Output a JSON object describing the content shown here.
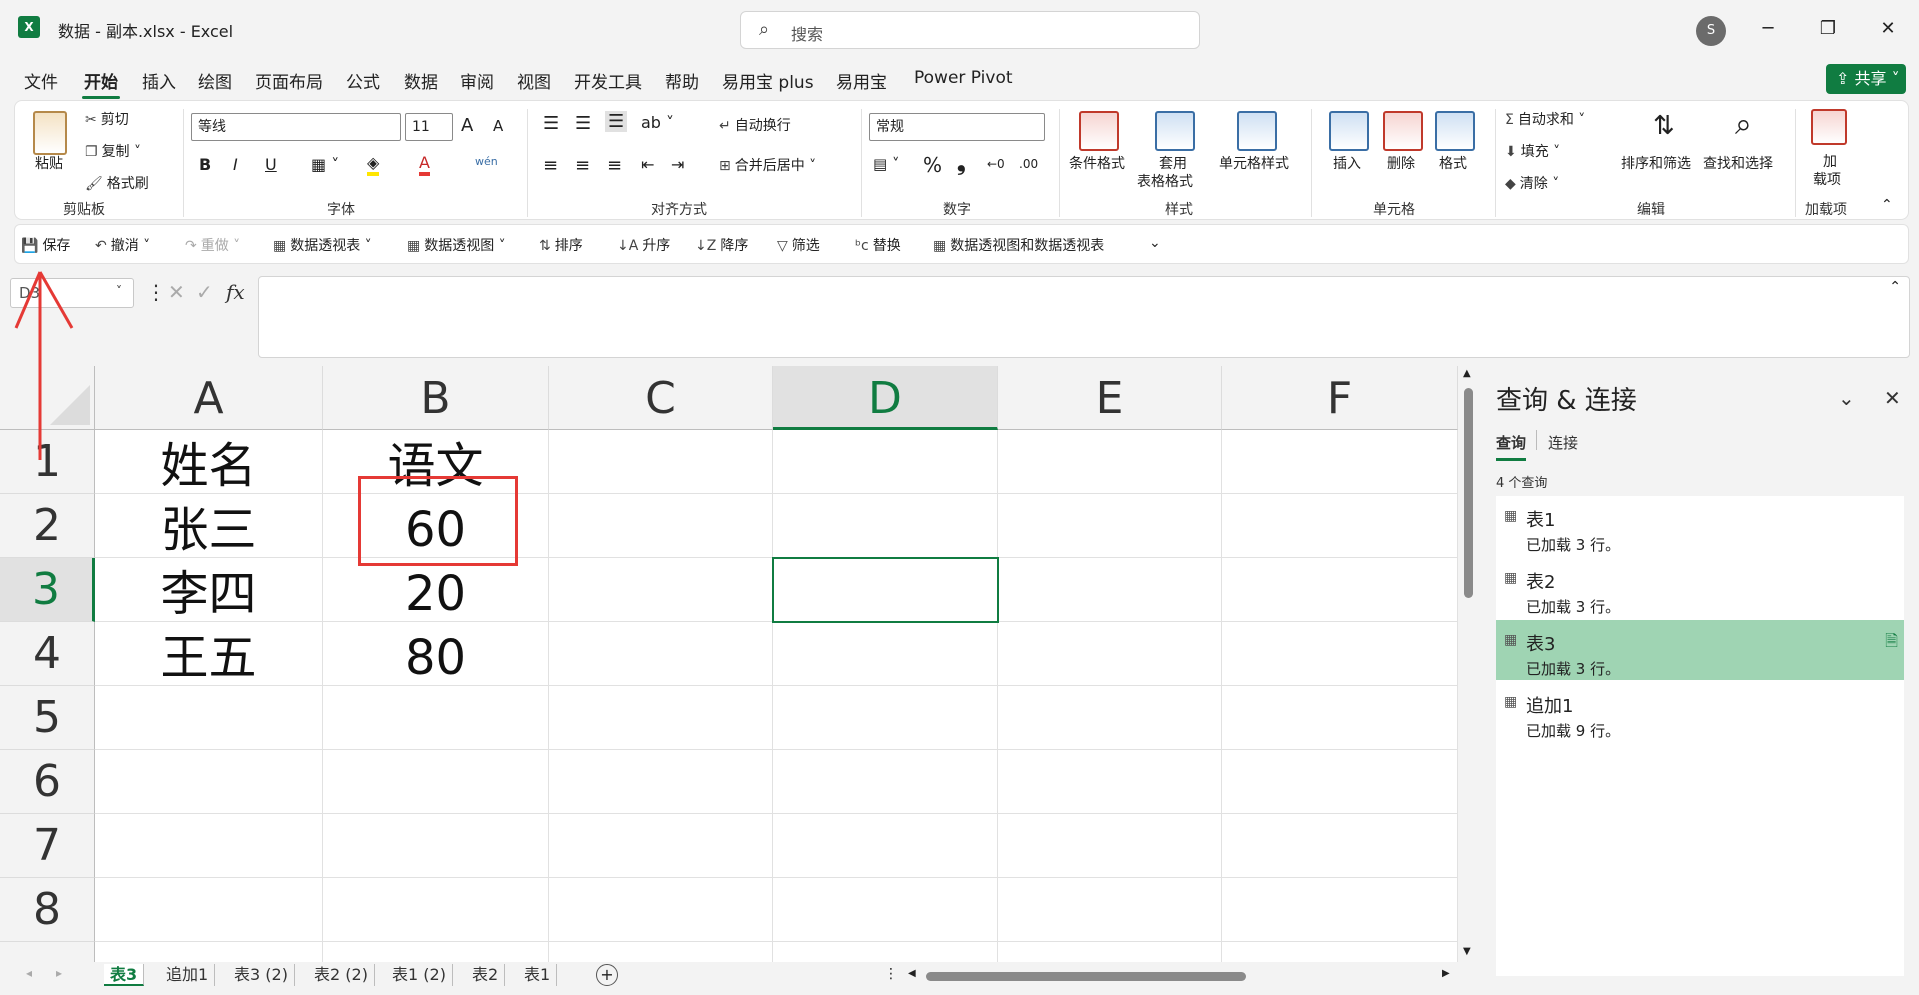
{
  "window": {
    "title": "数据 - 副本.xlsx  -  Excel",
    "app_letter": "X",
    "search_placeholder": "搜索",
    "user_initial": "S",
    "minimize": "─",
    "restore": "❐",
    "close": "✕"
  },
  "menu": {
    "items": [
      "文件",
      "开始",
      "插入",
      "绘图",
      "页面布局",
      "公式",
      "数据",
      "审阅",
      "视图",
      "开发工具",
      "帮助",
      "易用宝 plus",
      "易用宝",
      "Power Pivot"
    ],
    "active": "开始",
    "share": "共享"
  },
  "ribbon": {
    "clipboard": {
      "label": "剪贴板",
      "paste": "粘贴",
      "cut": "剪切",
      "copy": "复制",
      "format_painter": "格式刷"
    },
    "font": {
      "label": "字体",
      "name": "等线",
      "size": "11",
      "bold": "B",
      "italic": "I",
      "underline": "U",
      "grow": "A",
      "shrink": "A"
    },
    "alignment": {
      "label": "对齐方式",
      "wrap": "自动换行",
      "merge": "合并后居中"
    },
    "number": {
      "label": "数字",
      "format": "常规",
      "percent": "%",
      "comma": "❟"
    },
    "styles": {
      "label": "样式",
      "conditional": "条件格式",
      "table_line1": "套用",
      "table_line2": "表格格式",
      "cell_styles": "单元格样式"
    },
    "cells": {
      "label": "单元格",
      "insert": "插入",
      "delete": "删除",
      "format": "格式"
    },
    "editing": {
      "label": "编辑",
      "autosum": "自动求和",
      "fill": "填充",
      "clear": "清除",
      "sort_filter": "排序和筛选",
      "find_select": "查找和选择"
    },
    "addins": {
      "label": "加载项",
      "line1": "加",
      "line2": "载项"
    }
  },
  "qat": {
    "save": "保存",
    "undo": "撤消",
    "redo": "重做",
    "pivot_table": "数据透视表",
    "pivot_chart": "数据透视图",
    "sort": "排序",
    "asc": "升序",
    "desc": "降序",
    "filter": "筛选",
    "replace": "替换",
    "pivot_both": "数据透视图和数据透视表"
  },
  "formula": {
    "namebox": "D3",
    "fx": "fx",
    "value": ""
  },
  "grid": {
    "columns": [
      "A",
      "B",
      "C",
      "D",
      "E",
      "F"
    ],
    "selected_column": "D",
    "rows": [
      "1",
      "2",
      "3",
      "4",
      "5",
      "6",
      "7",
      "8"
    ],
    "selected_row": "3",
    "cells": {
      "A1": "姓名",
      "B1": "语文",
      "A2": "张三",
      "B2": "60",
      "A3": "李四",
      "B3": "20",
      "A4": "王五",
      "B4": "80"
    }
  },
  "sheets": {
    "tabs": [
      "表3",
      "追加1",
      "表3 (2)",
      "表2 (2)",
      "表1 (2)",
      "表2",
      "表1"
    ],
    "active": "表3",
    "add": "+"
  },
  "pane": {
    "title": "查询 & 连接",
    "tabs": [
      "查询",
      "连接"
    ],
    "active_tab": "查询",
    "count": "4 个查询",
    "queries": [
      {
        "name": "表1",
        "status": "已加载 3 行。"
      },
      {
        "name": "表2",
        "status": "已加载 3 行。"
      },
      {
        "name": "表3",
        "status": "已加载 3 行。"
      },
      {
        "name": "追加1",
        "status": "已加载 9 行。"
      }
    ],
    "selected_query": "表3"
  },
  "colors": {
    "accent": "#107c41",
    "annotation": "#e53935",
    "selected_query_bg": "#9fd4b3"
  }
}
